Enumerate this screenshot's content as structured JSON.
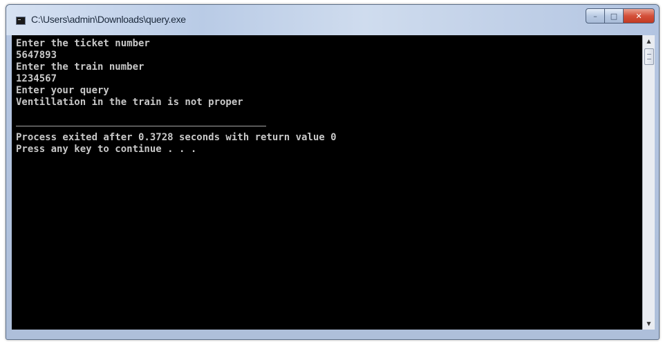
{
  "window": {
    "title": "C:\\Users\\admin\\Downloads\\query.exe",
    "icon": "console-app-icon",
    "buttons": {
      "minimize": "–",
      "maximize": "□",
      "close": "✕"
    }
  },
  "console": {
    "lines": [
      "Enter the ticket number",
      "5647893",
      "Enter the train number",
      "1234567",
      "Enter your query",
      "Ventillation in the train is not proper",
      "",
      "",
      "Process exited after 0.3728 seconds with return value 0",
      "Press any key to continue . . ."
    ]
  },
  "scrollbar": {
    "up_arrow": "▲",
    "down_arrow": "▼"
  }
}
